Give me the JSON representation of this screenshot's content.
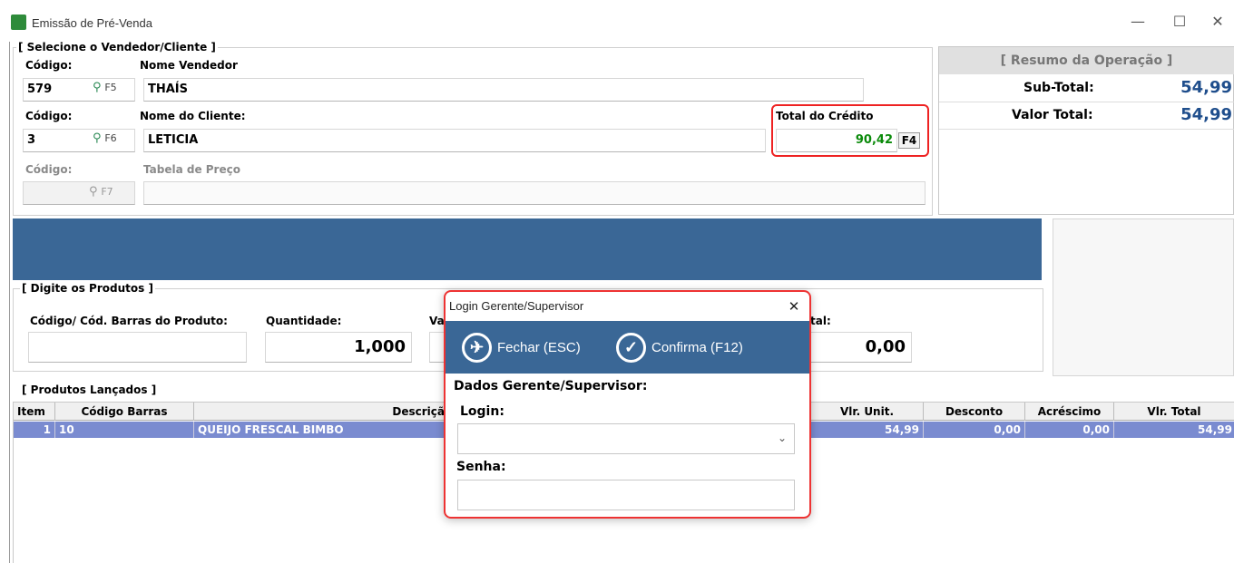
{
  "window": {
    "title": "Emissão de Pré-Venda",
    "minimize_glyph": "—",
    "maximize_glyph": "☐",
    "close_glyph": "✕"
  },
  "vendor_client": {
    "group_title": "[ Selecione o Vendedor/Cliente ]",
    "vendor": {
      "code_label": "Código:",
      "name_label": "Nome Vendedor",
      "code_value": "579",
      "fkey": "F5",
      "name_value": "THAÍS"
    },
    "client": {
      "code_label": "Código:",
      "name_label": "Nome do Cliente:",
      "code_value": "3",
      "fkey": "F6",
      "name_value": "LETICIA"
    },
    "price_table": {
      "code_label": "Código:",
      "name_label": "Tabela de Preço",
      "code_value": "",
      "fkey": "F7",
      "name_value": ""
    },
    "credit": {
      "label": "Total do Crédito",
      "value": "90,42",
      "fkey": "F4",
      "value_color": "#0a8a0a"
    }
  },
  "resumo": {
    "title": "[ Resumo da Operação ]",
    "subtotal_label": "Sub-Total:",
    "subtotal_value": "54,99",
    "total_label": "Valor Total:",
    "total_value": "54,99",
    "value_color": "#1f4e8c"
  },
  "products_entry": {
    "group_title": "[ Digite os Produtos ]",
    "barcode_label": "Código/ Cód. Barras do Produto:",
    "barcode_value": "",
    "qty_label": "Quantidade:",
    "qty_value": "1,000",
    "val_label_partial": "Va",
    "total_label_partial": "tal:",
    "total_value": "0,00"
  },
  "products_list": {
    "group_title": "[ Produtos Lançados ]",
    "columns": [
      "Item",
      "Código Barras",
      "Descriçã",
      "Vlr. Unit.",
      "Desconto",
      "Acréscimo",
      "Vlr. Total"
    ],
    "rows": [
      {
        "item": "1",
        "barcode": "10",
        "description": "QUEIJO FRESCAL BIMBO",
        "unit": "54,99",
        "discount": "0,00",
        "addition": "0,00",
        "total": "54,99"
      }
    ]
  },
  "dialog": {
    "title": "Login Gerente/Supervisor",
    "close_glyph": "✕",
    "close_button_label": "Fechar (ESC)",
    "confirm_button_label": "Confirma (F12)",
    "section_title": "Dados Gerente/Supervisor:",
    "login_label": "Login:",
    "login_value": "",
    "password_label": "Senha:",
    "password_value": ""
  },
  "colors": {
    "accent_blue": "#3a6796",
    "selected_row": "#7a8bd0",
    "highlight_red": "#e22222"
  }
}
